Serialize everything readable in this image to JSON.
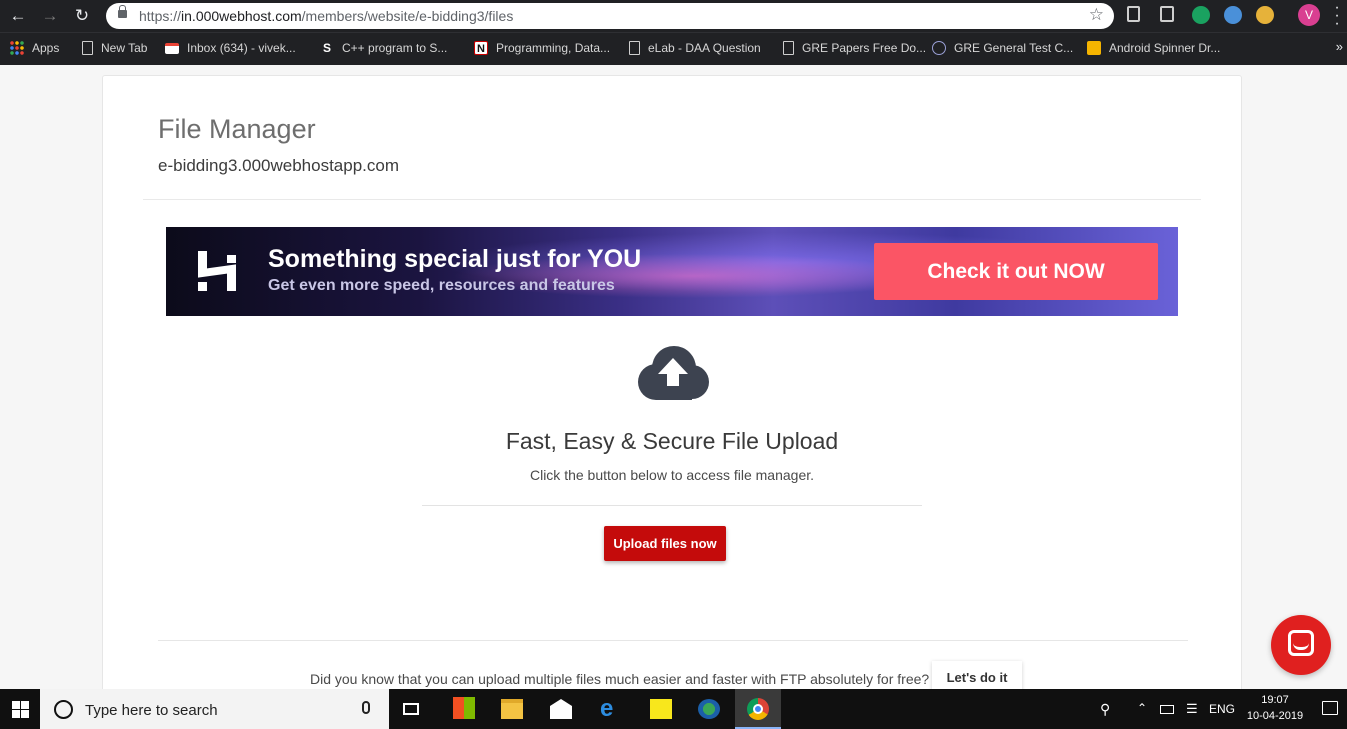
{
  "browser": {
    "url_prefix": "https://",
    "url_host": "in.000webhost.com",
    "url_path": "/members/website/e-bidding3/files",
    "profile_initial": "V",
    "bookmarks": [
      {
        "label": "Apps",
        "icon": "apps-grid-icon"
      },
      {
        "label": "New Tab",
        "icon": "page-icon"
      },
      {
        "label": "Inbox (634) - vivek...",
        "icon": "gmail-icon"
      },
      {
        "label": "C++ program to S...",
        "icon": "s-icon"
      },
      {
        "label": "Programming, Data...",
        "icon": "n-icon"
      },
      {
        "label": "eLab - DAA Question",
        "icon": "page-icon"
      },
      {
        "label": "GRE Papers Free Do...",
        "icon": "page-icon"
      },
      {
        "label": "GRE General Test C...",
        "icon": "globe-icon"
      },
      {
        "label": "Android Spinner Dr...",
        "icon": "bookmark-yellow-icon"
      }
    ],
    "more_label": "»"
  },
  "page": {
    "title": "File Manager",
    "subtitle": "e-bidding3.000webhostapp.com",
    "banner": {
      "headline": "Something special just for YOU",
      "subline": "Get even more speed, resources and features",
      "cta": "Check it out NOW"
    },
    "upload": {
      "title": "Fast, Easy & Secure File Upload",
      "subtitle": "Click the button below to access file manager.",
      "button": "Upload files now"
    },
    "ftp": {
      "text": "Did you know that you can upload multiple files much easier and faster with FTP absolutely for free?",
      "button": "Let's do it"
    }
  },
  "taskbar": {
    "search_placeholder": "Type here to search",
    "language": "ENG",
    "time": "19:07",
    "date": "10-04-2019"
  },
  "colors": {
    "upload_button": "#c40b0b",
    "banner_cta": "#fb5565",
    "chat_button": "#e0201f"
  }
}
